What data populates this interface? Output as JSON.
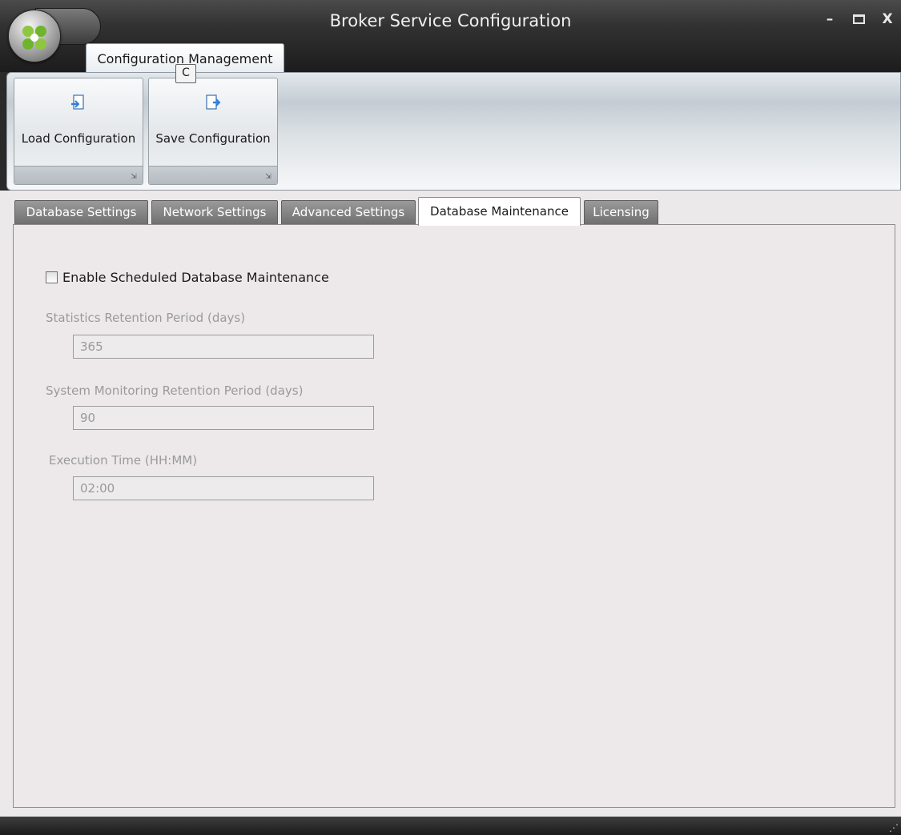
{
  "window": {
    "title": "Broker Service Configuration",
    "controls": {
      "minimize": "–",
      "close": "X"
    }
  },
  "ribbon": {
    "tab_label": "Configuration Management",
    "keytip": "C",
    "buttons": [
      {
        "label": "Load Configuration",
        "icon": "load-document-icon"
      },
      {
        "label": "Save Configuration",
        "icon": "save-document-icon"
      }
    ]
  },
  "tabs": [
    {
      "label": "Database Settings",
      "active": false
    },
    {
      "label": "Network Settings",
      "active": false
    },
    {
      "label": "Advanced Settings",
      "active": false
    },
    {
      "label": "Database Maintenance",
      "active": true
    },
    {
      "label": "Licensing",
      "active": false
    }
  ],
  "maintenance": {
    "enable_label": "Enable Scheduled Database Maintenance",
    "enabled": false,
    "stats_label": "Statistics Retention Period (days)",
    "stats_value": "365",
    "monitor_label": "System Monitoring Retention Period (days)",
    "monitor_value": "90",
    "exec_label": "Execution Time (HH:MM)",
    "exec_value": "02:00"
  },
  "colors": {
    "titlebar": "#323232",
    "active_tab": "#ffffff",
    "inactive_tab": "#808080",
    "panel": "#ede9ea",
    "disabled_text": "#9a9a9a"
  }
}
